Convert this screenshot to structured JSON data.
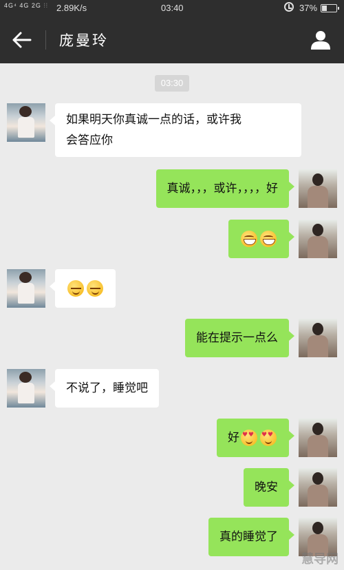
{
  "status_bar": {
    "signal_text": "4G⁴ 4G 2G ⫶⫶",
    "network_speed": "2.89K/s",
    "time": "03:40",
    "alarm_icon": "alarm-clock-icon",
    "battery_percent": "37%",
    "battery_level": 0.37
  },
  "header": {
    "back_icon": "arrow-left-icon",
    "contact_name": "庞曼玲",
    "profile_icon": "person-icon",
    "background_color": "#2e2e2e"
  },
  "chat": {
    "timestamp": "03:30",
    "incoming_bubble_color": "#ffffff",
    "outgoing_bubble_color": "#95e45a",
    "messages": [
      {
        "sender": "contact",
        "line1": "如果明天你真诚一点的话，或许我",
        "line2": "会答应你"
      },
      {
        "sender": "me",
        "text": "真诚，，，或许，，，，好"
      },
      {
        "sender": "me",
        "emojis": [
          "grin-icon",
          "grin-icon"
        ]
      },
      {
        "sender": "contact",
        "emojis": [
          "smirk-icon",
          "smirk-icon"
        ]
      },
      {
        "sender": "me",
        "text": "能在提示一点么"
      },
      {
        "sender": "contact",
        "text": "不说了，睡觉吧"
      },
      {
        "sender": "me",
        "text": "好",
        "emojis": [
          "heart-eyes-icon",
          "heart-eyes-icon"
        ]
      },
      {
        "sender": "me",
        "text": "晚安"
      },
      {
        "sender": "me",
        "text": "真的睡觉了"
      }
    ]
  },
  "watermark": "慧导网"
}
